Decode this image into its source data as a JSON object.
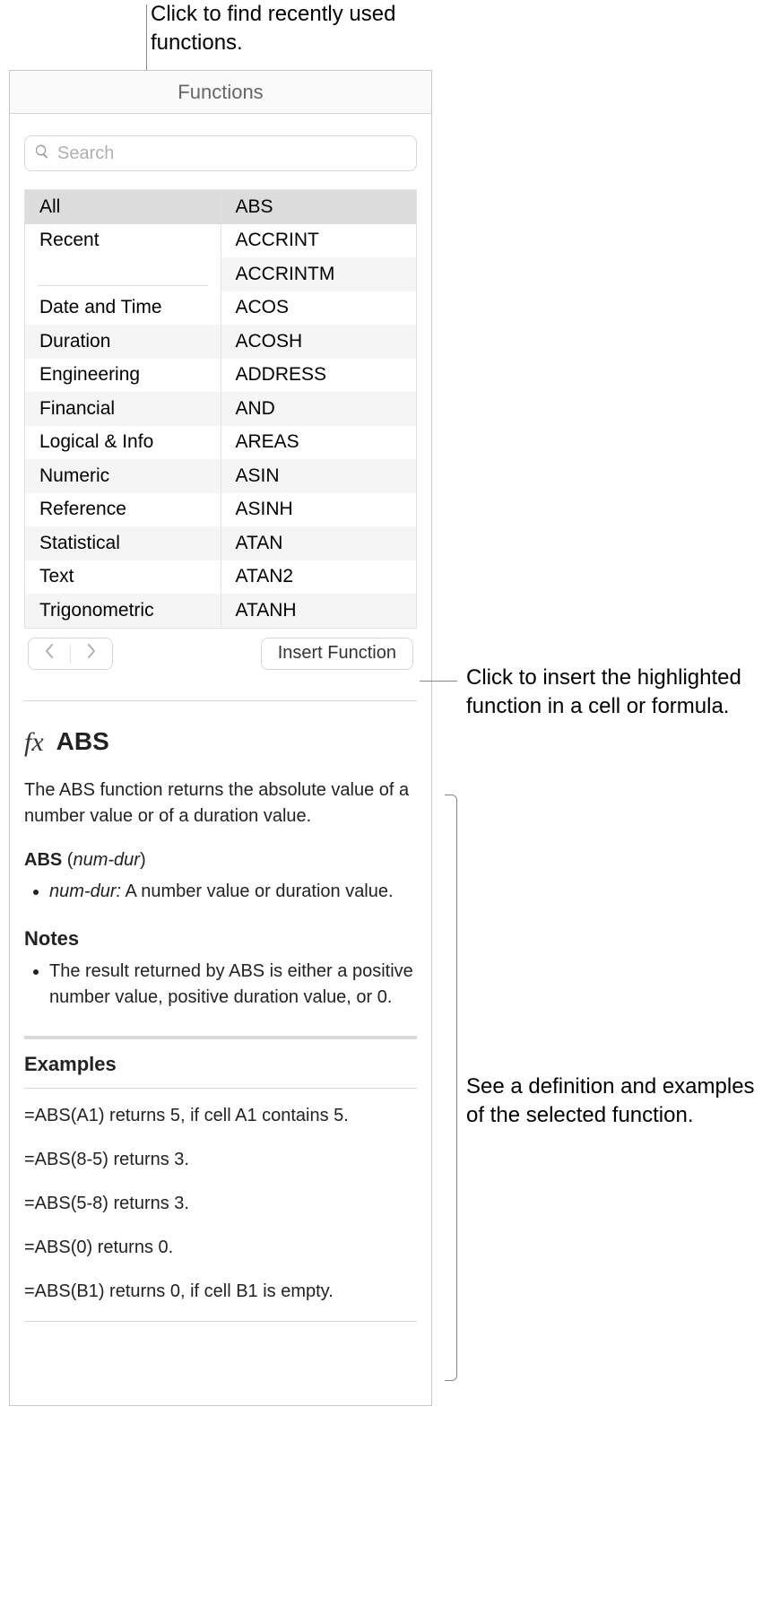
{
  "callouts": {
    "recent": "Click to find recently used functions.",
    "insert": "Click to insert the highlighted function in a cell or formula.",
    "detail": "See a definition and examples of the selected function."
  },
  "panel": {
    "title": "Functions",
    "search_placeholder": "Search"
  },
  "categories": [
    "All",
    "Recent",
    "",
    "Date and Time",
    "Duration",
    "Engineering",
    "Financial",
    "Logical & Info",
    "Numeric",
    "Reference",
    "Statistical",
    "Text",
    "Trigonometric"
  ],
  "functions": [
    "ABS",
    "ACCRINT",
    "ACCRINTM",
    "ACOS",
    "ACOSH",
    "ADDRESS",
    "AND",
    "AREAS",
    "ASIN",
    "ASINH",
    "ATAN",
    "ATAN2",
    "ATANH"
  ],
  "toolbar": {
    "insert_label": "Insert Function"
  },
  "detail": {
    "fx_symbol": "fx",
    "name": "ABS",
    "description": "The ABS function returns the absolute value of a number value or of a duration value.",
    "syntax_fn": "ABS",
    "syntax_arg": "num-dur",
    "args": [
      {
        "name": "num-dur:",
        "desc": " A number value or duration value."
      }
    ],
    "notes_head": "Notes",
    "notes": [
      "The result returned by ABS is either a positive number value, positive duration value, or 0."
    ],
    "examples_head": "Examples",
    "examples": [
      "=ABS(A1) returns 5, if cell A1 contains 5.",
      "=ABS(8-5) returns 3.",
      "=ABS(5-8) returns 3.",
      "=ABS(0) returns 0.",
      "=ABS(B1) returns 0, if cell B1 is empty."
    ]
  }
}
